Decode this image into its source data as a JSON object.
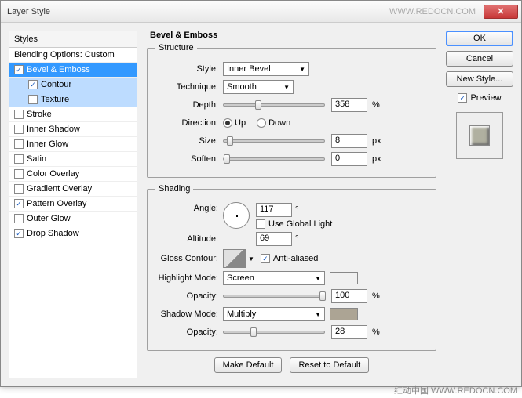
{
  "window": {
    "title": "Layer Style",
    "watermark_header": "WWW.REDOCN.COM"
  },
  "buttons": {
    "ok": "OK",
    "cancel": "Cancel",
    "new_style": "New Style...",
    "preview": "Preview",
    "close": "✕",
    "make_default": "Make Default",
    "reset_default": "Reset to Default"
  },
  "styles": {
    "header": "Styles",
    "blending": "Blending Options: Custom",
    "items": [
      {
        "label": "Bevel & Emboss",
        "checked": true,
        "selected": true
      },
      {
        "label": "Contour",
        "checked": true,
        "sub": true
      },
      {
        "label": "Texture",
        "checked": false,
        "sub": true
      },
      {
        "label": "Stroke",
        "checked": false
      },
      {
        "label": "Inner Shadow",
        "checked": false
      },
      {
        "label": "Inner Glow",
        "checked": false
      },
      {
        "label": "Satin",
        "checked": false
      },
      {
        "label": "Color Overlay",
        "checked": false
      },
      {
        "label": "Gradient Overlay",
        "checked": false
      },
      {
        "label": "Pattern Overlay",
        "checked": true
      },
      {
        "label": "Outer Glow",
        "checked": false
      },
      {
        "label": "Drop Shadow",
        "checked": true
      }
    ]
  },
  "panel": {
    "title": "Bevel & Emboss",
    "structure": {
      "legend": "Structure",
      "style_lbl": "Style:",
      "style_val": "Inner Bevel",
      "technique_lbl": "Technique:",
      "technique_val": "Smooth",
      "depth_lbl": "Depth:",
      "depth_val": "358",
      "depth_unit": "%",
      "direction_lbl": "Direction:",
      "up": "Up",
      "down": "Down",
      "dir": "up",
      "size_lbl": "Size:",
      "size_val": "8",
      "size_unit": "px",
      "soften_lbl": "Soften:",
      "soften_val": "0",
      "soften_unit": "px"
    },
    "shading": {
      "legend": "Shading",
      "angle_lbl": "Angle:",
      "angle_val": "117",
      "deg": "°",
      "global_light": "Use Global Light",
      "global_checked": false,
      "altitude_lbl": "Altitude:",
      "altitude_val": "69",
      "gloss_lbl": "Gloss Contour:",
      "antialias": "Anti-aliased",
      "aa_checked": true,
      "highlight_lbl": "Highlight Mode:",
      "highlight_val": "Screen",
      "highlight_color": "#ffffff",
      "h_opacity_lbl": "Opacity:",
      "h_opacity_val": "100",
      "pct": "%",
      "shadow_lbl": "Shadow Mode:",
      "shadow_val": "Multiply",
      "shadow_color": "#aca494",
      "s_opacity_lbl": "Opacity:",
      "s_opacity_val": "28"
    }
  },
  "footer": {
    "watermark": "红动中国 WWW.REDOCN.COM"
  }
}
